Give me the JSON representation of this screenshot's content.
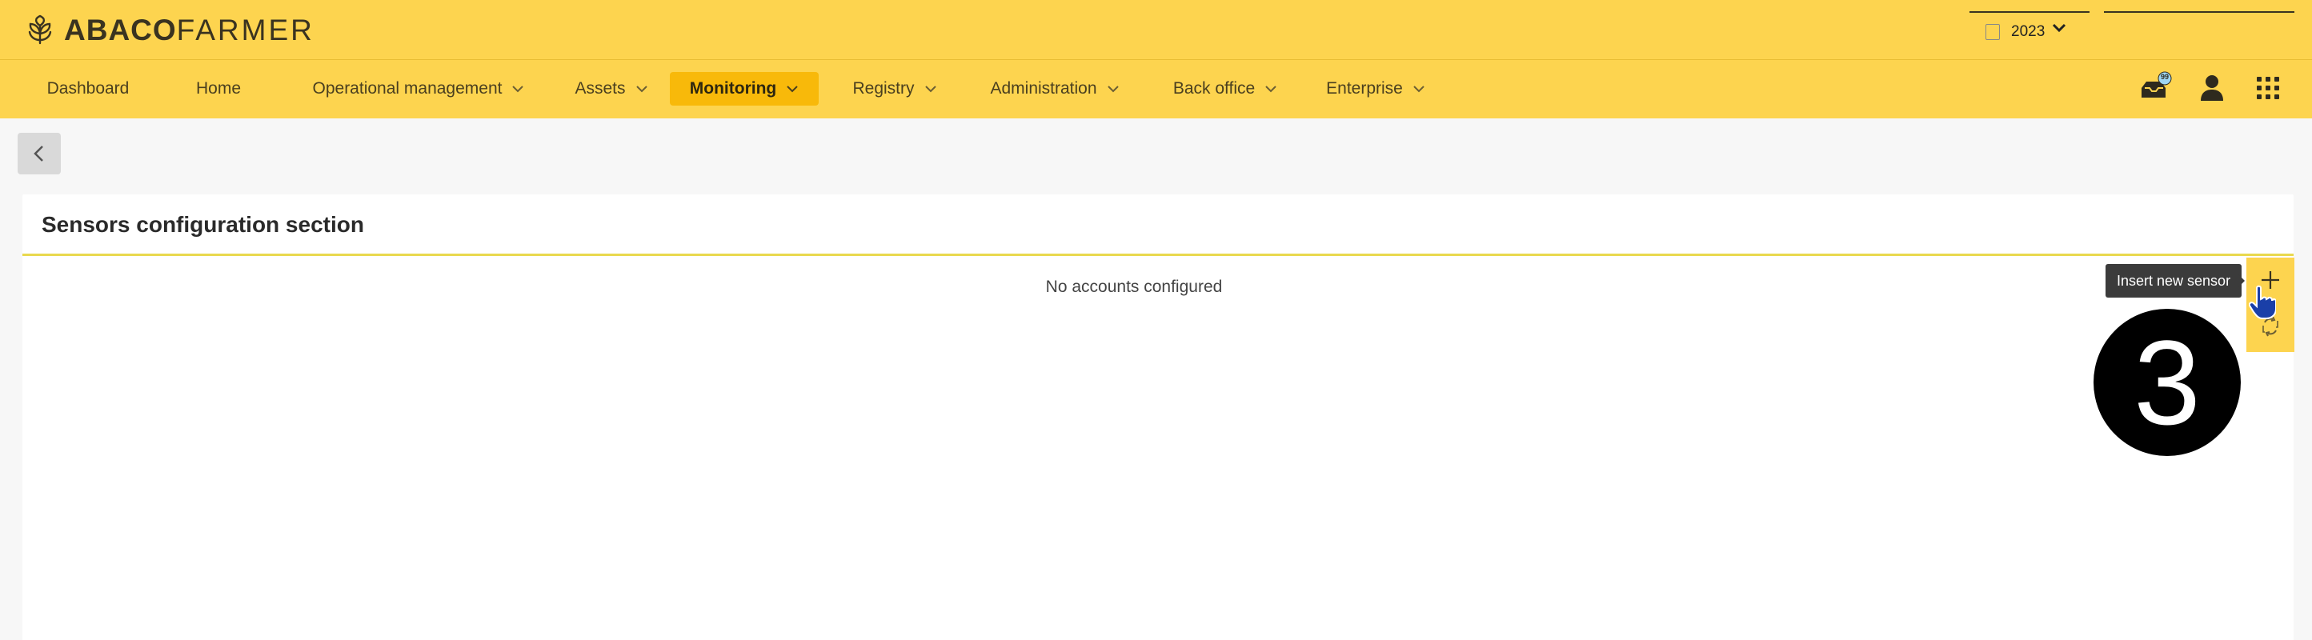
{
  "brand": {
    "bold": "ABACO",
    "light": "FARMER",
    "icon": "wheat-leaf-icon"
  },
  "year_picker": {
    "value": "2023",
    "icon": "calendar-icon"
  },
  "nav": [
    {
      "label": "Dashboard",
      "has_menu": false
    },
    {
      "label": "Home",
      "has_menu": false
    },
    {
      "label": "Operational management",
      "has_menu": true
    },
    {
      "label": "Assets",
      "has_menu": true
    },
    {
      "label": "Monitoring",
      "has_menu": true,
      "active": true
    },
    {
      "label": "Registry",
      "has_menu": true
    },
    {
      "label": "Administration",
      "has_menu": true
    },
    {
      "label": "Back office",
      "has_menu": true
    },
    {
      "label": "Enterprise",
      "has_menu": true
    }
  ],
  "header_icons": {
    "notifications_badge": "99"
  },
  "panel": {
    "title": "Sensors configuration section",
    "empty_message": "No accounts configured"
  },
  "actions": {
    "insert_tooltip": "Insert new sensor"
  },
  "step_badge": "3",
  "colors": {
    "brand_yellow": "#fdd44f",
    "active_nav": "#f8b90a",
    "divider": "#e9d94e"
  }
}
